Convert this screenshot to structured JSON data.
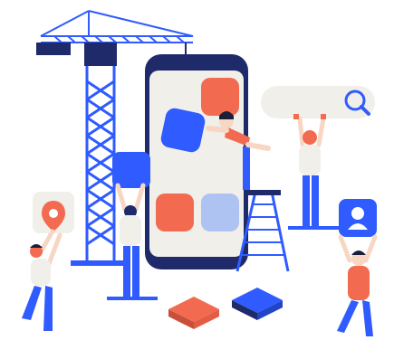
{
  "illustration": {
    "theme": "mobile app construction",
    "icons": {
      "search": "search-icon",
      "location": "location-pin-icon",
      "profile": "user-profile-icon",
      "crane": "construction-crane-icon",
      "ladder": "ladder-icon"
    },
    "colors": {
      "navy": "#1F2A6B",
      "blue": "#2F5BFF",
      "light_blue": "#AFC3F2",
      "coral": "#F26B50",
      "cream": "#F1EFEA",
      "skin": "#F7D7C4",
      "dark_hair": "#1B1F3A"
    }
  }
}
